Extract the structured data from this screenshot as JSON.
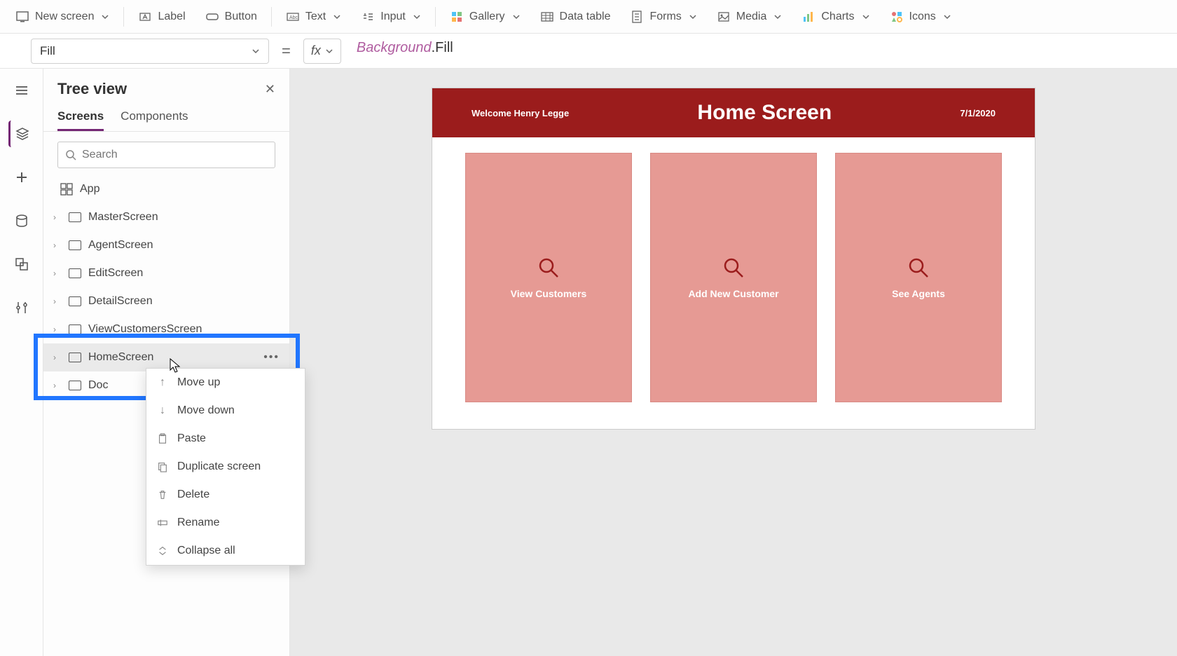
{
  "toolbar": {
    "new_screen": "New screen",
    "label": "Label",
    "button": "Button",
    "text": "Text",
    "input": "Input",
    "gallery": "Gallery",
    "data_table": "Data table",
    "forms": "Forms",
    "media": "Media",
    "charts": "Charts",
    "icons": "Icons"
  },
  "formula": {
    "prop": "Fill",
    "fx": "fx",
    "value_part1": "Background",
    "value_part2": ".Fill"
  },
  "tree": {
    "title": "Tree view",
    "tabs": {
      "screens": "Screens",
      "components": "Components"
    },
    "search_placeholder": "Search",
    "app": "App",
    "items": [
      "MasterScreen",
      "AgentScreen",
      "EditScreen",
      "DetailScreen",
      "ViewCustomersScreen",
      "HomeScreen",
      "Doc"
    ]
  },
  "context_menu": {
    "move_up": "Move up",
    "move_down": "Move down",
    "paste": "Paste",
    "duplicate": "Duplicate screen",
    "delete": "Delete",
    "rename": "Rename",
    "collapse": "Collapse all"
  },
  "screen": {
    "welcome": "Welcome Henry Legge",
    "title": "Home Screen",
    "date": "7/1/2020",
    "cards": [
      "View Customers",
      "Add New Customer",
      "See Agents"
    ]
  }
}
